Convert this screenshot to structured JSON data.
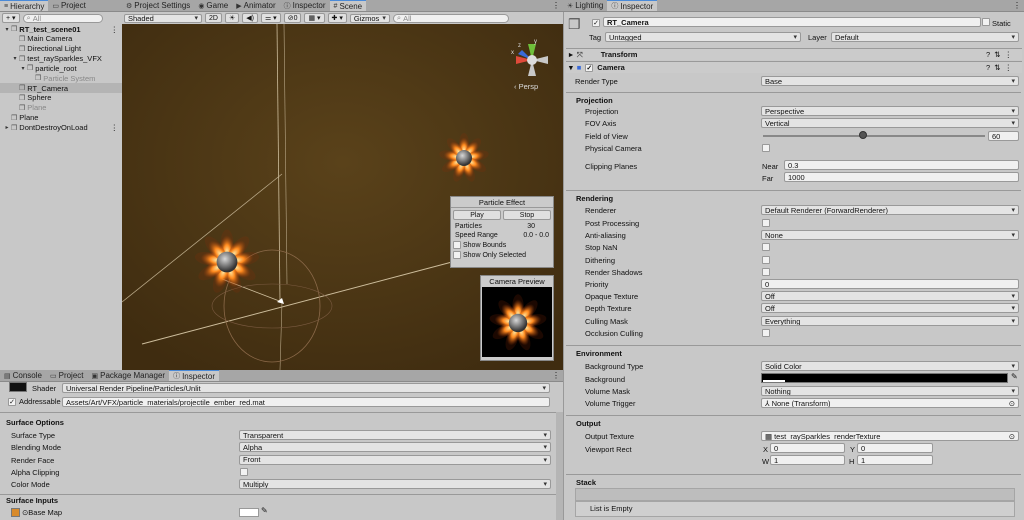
{
  "hierarchy": {
    "tab": "Hierarchy",
    "tab2": "Project",
    "search_placeholder": "All",
    "items": [
      {
        "label": "RT_test_scene01",
        "indent": 0,
        "arrow": "▾",
        "bold": true
      },
      {
        "label": "Main Camera",
        "indent": 1,
        "arrow": ""
      },
      {
        "label": "Directional Light",
        "indent": 1,
        "arrow": ""
      },
      {
        "label": "test_raySparkles_VFX",
        "indent": 1,
        "arrow": "▾"
      },
      {
        "label": "particle_root",
        "indent": 2,
        "arrow": "▾"
      },
      {
        "label": "Particle System",
        "indent": 3,
        "arrow": "",
        "dim": true
      },
      {
        "label": "RT_Camera",
        "indent": 1,
        "arrow": "",
        "selected": true
      },
      {
        "label": "Sphere",
        "indent": 1,
        "arrow": ""
      },
      {
        "label": "Plane",
        "indent": 1,
        "arrow": "",
        "dim": true
      },
      {
        "label": "Plane",
        "indent": 0,
        "arrow": ""
      },
      {
        "label": "DontDestroyOnLoad",
        "indent": 0,
        "arrow": "▸"
      }
    ]
  },
  "scene_tabs": [
    "Project Settings",
    "Game",
    "Animator",
    "Inspector",
    "Scene"
  ],
  "scene_toolbar": {
    "shading": "Shaded",
    "mode2d": "2D",
    "gizmos": "Gizmos",
    "search_placeholder": "All",
    "hidden_count": "0"
  },
  "scene": {
    "persp": "Persp",
    "gizmo_axes": {
      "x": "x",
      "y": "y",
      "z": "z"
    }
  },
  "particle_effect": {
    "title": "Particle Effect",
    "play": "Play",
    "stop": "Stop",
    "particles_label": "Particles",
    "particles_value": "30",
    "speed_label": "Speed Range",
    "speed_value": "0.0 - 0.0",
    "show_bounds": "Show Bounds",
    "show_only_selected": "Show Only Selected"
  },
  "camera_preview": {
    "title": "Camera Preview"
  },
  "bottom": {
    "tabs": [
      "Console",
      "Project",
      "Package Manager",
      "Inspector"
    ],
    "shader_label": "Shader",
    "shader_value": "Universal Render Pipeline/Particles/Unlit",
    "addressable_label": "Addressable",
    "addressable_path": "Assets/Art/VFX/particle_materials/projectile_ember_red.mat",
    "surface_options": "Surface Options",
    "rows": [
      {
        "label": "Surface Type",
        "value": "Transparent"
      },
      {
        "label": "Blending Mode",
        "value": "Alpha"
      },
      {
        "label": "Render Face",
        "value": "Front"
      },
      {
        "label": "Alpha Clipping",
        "value": ""
      },
      {
        "label": "Color Mode",
        "value": "Multiply"
      }
    ],
    "surface_inputs": "Surface Inputs",
    "base_map": "Base Map"
  },
  "inspector": {
    "tabs": [
      "Lighting",
      "Inspector"
    ],
    "object_name": "RT_Camera",
    "static_label": "Static",
    "tag_label": "Tag",
    "tag_value": "Untagged",
    "layer_label": "Layer",
    "layer_value": "Default",
    "transform": "Transform",
    "camera": "Camera",
    "render_type_label": "Render Type",
    "render_type": "Base",
    "projection": "Projection",
    "projection_label": "Projection",
    "projection_value": "Perspective",
    "fov_axis_label": "FOV Axis",
    "fov_axis_value": "Vertical",
    "fov_label": "Field of View",
    "fov_value": "60",
    "fov_fraction": 0.45,
    "physical_label": "Physical Camera",
    "clipping_label": "Clipping Planes",
    "near_label": "Near",
    "near_value": "0.3",
    "far_label": "Far",
    "far_value": "1000",
    "rendering": "Rendering",
    "renderer_label": "Renderer",
    "renderer_value": "Default Renderer (ForwardRenderer)",
    "post_label": "Post Processing",
    "aa_label": "Anti-aliasing",
    "aa_value": "None",
    "stopnan_label": "Stop NaN",
    "dither_label": "Dithering",
    "shadows_label": "Render Shadows",
    "priority_label": "Priority",
    "priority_value": "0",
    "opaque_label": "Opaque Texture",
    "opaque_value": "Off",
    "depth_label": "Depth Texture",
    "depth_value": "Off",
    "culling_label": "Culling Mask",
    "culling_value": "Everything",
    "occlusion_label": "Occlusion Culling",
    "environment": "Environment",
    "bgtype_label": "Background Type",
    "bgtype_value": "Solid Color",
    "bg_label": "Background",
    "volmask_label": "Volume Mask",
    "volmask_value": "Nothing",
    "voltrig_label": "Volume Trigger",
    "voltrig_value": "None (Transform)",
    "output": "Output",
    "outtex_label": "Output Texture",
    "outtex_value": "test_raySparkles_renderTexture",
    "viewport_label": "Viewport Rect",
    "vx_label": "X",
    "vx": "0",
    "vy_label": "Y",
    "vy": "0",
    "vw_label": "W",
    "vw": "1",
    "vh_label": "H",
    "vh": "1",
    "stack": "Stack",
    "list_empty": "List is Empty"
  }
}
